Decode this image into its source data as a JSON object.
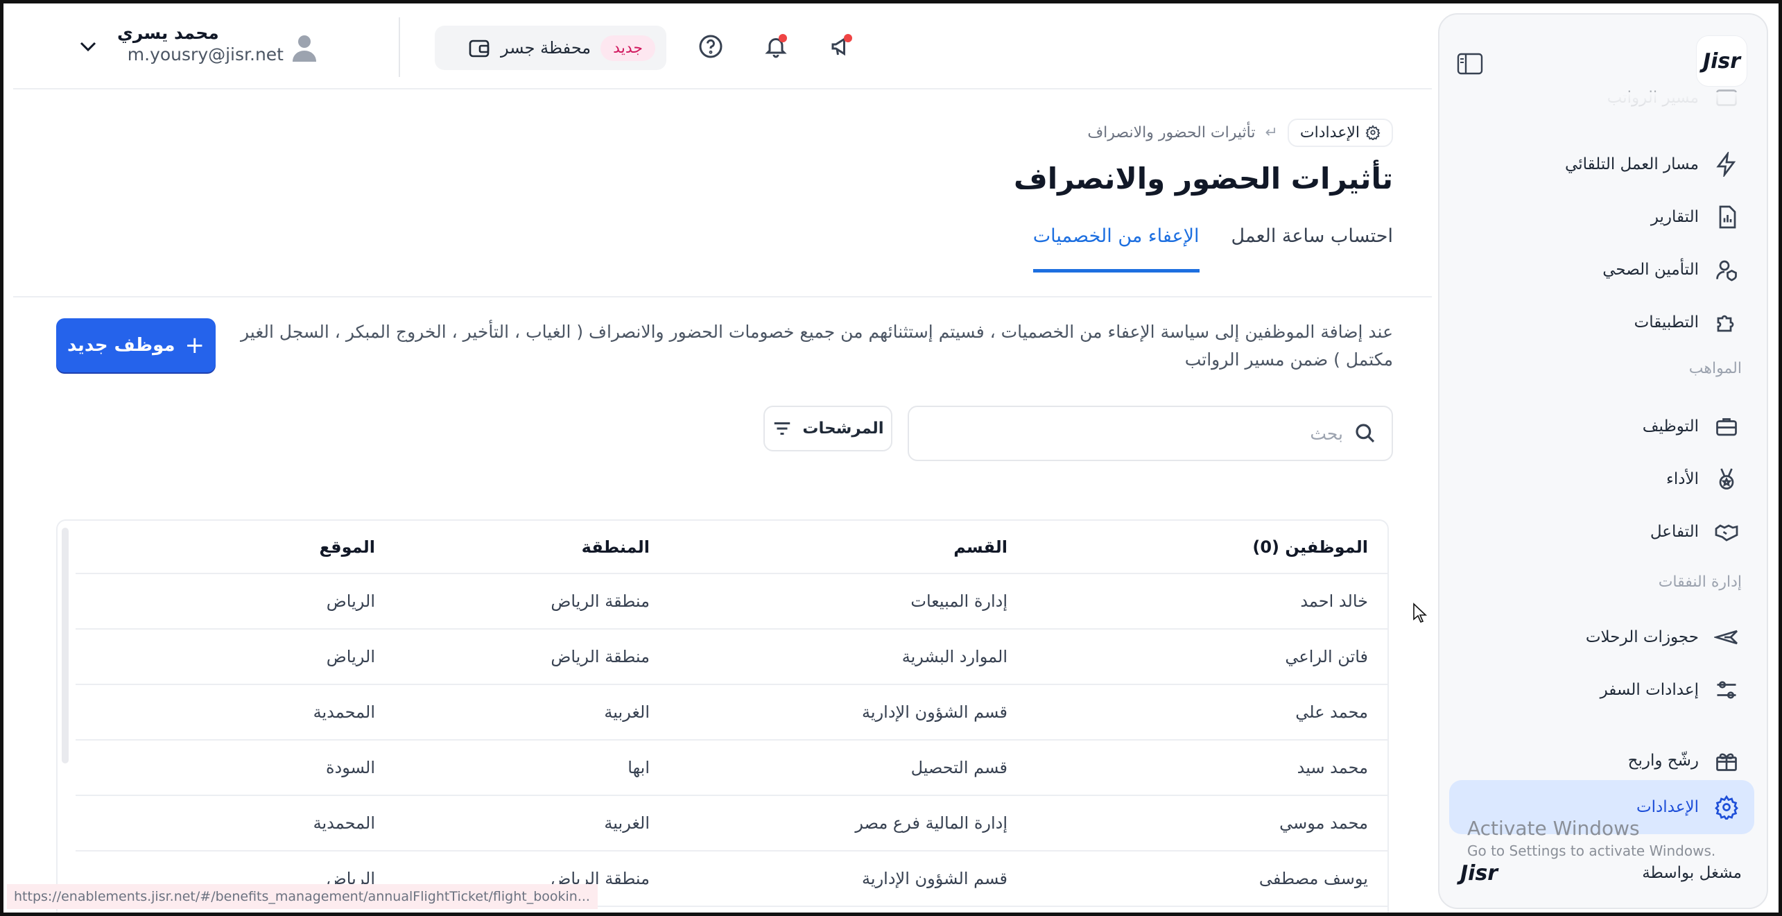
{
  "header": {
    "user_name": "محمد يسري",
    "user_email": "m.yousry@jisr.net",
    "wallet_label": "محفظة جسر",
    "wallet_badge": "جديد"
  },
  "breadcrumb": {
    "root": "الإعدادات",
    "current": "تأثيرات الحضور والانصراف"
  },
  "page": {
    "title": "تأثيرات الحضور والانصراف",
    "tabs": [
      {
        "label": "احتساب ساعة العمل",
        "active": false
      },
      {
        "label": "الإعفاء من الخصميات",
        "active": true
      }
    ],
    "description": "عند إضافة الموظفين إلى سياسة الإعفاء من الخصميات ، فسيتم إستثنائهم من جميع خصومات الحضور والانصراف ( الغياب ، التأخير ، الخروج المبكر ، السجل الغير مكتمل ) ضمن مسير الرواتب",
    "new_button": "موظف جديد",
    "search_placeholder": "بحث",
    "filters_label": "المرشحات"
  },
  "table": {
    "headers": [
      "الموظفين (0)",
      "القسم",
      "المنطقة",
      "الموقع"
    ],
    "rows": [
      [
        "خالد احمد",
        "إدارة المبيعات",
        "منطقة الرياض",
        "الرياض"
      ],
      [
        "فاتن الراعي",
        "الموارد البشرية",
        "منطقة الرياض",
        "الرياض"
      ],
      [
        "محمد علي",
        "قسم الشؤون الإدارية",
        "الغربية",
        "المحمدية"
      ],
      [
        "محمد سيد",
        "قسم التحصيل",
        "ابها",
        "السودة"
      ],
      [
        "محمد موسي",
        "إدارة المالية فرع مصر",
        "الغربية",
        "المحمدية"
      ],
      [
        "يوسف مصطفى",
        "قسم الشؤون الإدارية",
        "منطقة الرياض",
        "الرياض"
      ]
    ]
  },
  "sidebar": {
    "logo": "Jisr",
    "top_faded": "مسير الرواتب",
    "items": [
      {
        "label": "مسار العمل التلقائي",
        "icon": "automation-icon"
      },
      {
        "label": "التقارير",
        "icon": "report-icon"
      },
      {
        "label": "التأمين الصحي",
        "icon": "insurance-icon"
      },
      {
        "label": "التطبيقات",
        "icon": "puzzle-icon"
      }
    ],
    "section_talent": "المواهب",
    "talent_items": [
      {
        "label": "التوظيف",
        "icon": "briefcase-icon"
      },
      {
        "label": "الأداء",
        "icon": "medal-icon"
      },
      {
        "label": "التفاعل",
        "icon": "handshake-icon"
      }
    ],
    "section_expenses": "إدارة النفقات",
    "expense_items": [
      {
        "label": "حجوزات الرحلات",
        "icon": "plane-icon"
      },
      {
        "label": "إعدادات السفر",
        "icon": "sliders-icon"
      }
    ],
    "referral": "رشّح واربح",
    "settings": "الإعدادات",
    "footer_label": "مشغل بواسطة",
    "footer_brand": "Jisr",
    "activate_title": "Activate Windows",
    "activate_sub": "Go to Settings to activate Windows."
  },
  "statusbar": "https://enablements.jisr.net/#/benefits_management/annualFlightTicket/flight_bookin..."
}
